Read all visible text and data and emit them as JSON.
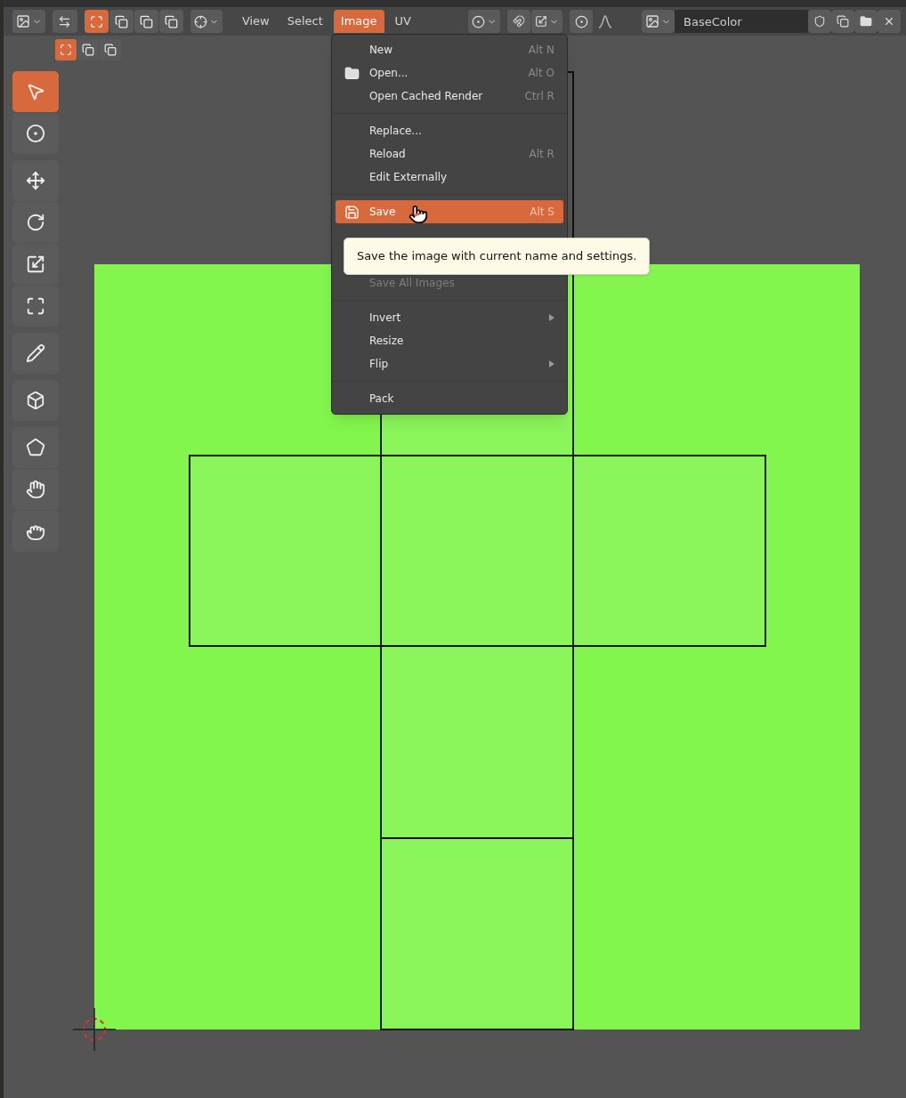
{
  "header": {
    "view_modes": [
      {
        "selected": true
      },
      {
        "selected": false
      },
      {
        "selected": false
      },
      {
        "selected": false
      }
    ],
    "menus": [
      {
        "label": "View",
        "selected": false
      },
      {
        "label": "Select",
        "selected": false
      },
      {
        "label": "Image",
        "selected": true
      },
      {
        "label": "UV",
        "selected": false
      }
    ],
    "image_field": {
      "value": "BaseColor"
    },
    "select_modes": [
      {
        "selected": true
      },
      {
        "selected": false
      },
      {
        "selected": false
      }
    ]
  },
  "image_menu": {
    "items": [
      {
        "kind": "item",
        "label": "New",
        "shortcut": "Alt N",
        "disabled": false,
        "selected": false
      },
      {
        "kind": "item",
        "label": "Open...",
        "shortcut": "Alt O",
        "disabled": false,
        "selected": false
      },
      {
        "kind": "item",
        "label": "Open Cached Render",
        "shortcut": "Ctrl R",
        "disabled": false,
        "selected": false
      },
      {
        "kind": "separator"
      },
      {
        "kind": "item",
        "label": "Replace...",
        "disabled": false,
        "selected": false
      },
      {
        "kind": "item",
        "label": "Reload",
        "shortcut": "Alt R",
        "disabled": false,
        "selected": false
      },
      {
        "kind": "item",
        "label": "Edit Externally",
        "disabled": false,
        "selected": false
      },
      {
        "kind": "separator"
      },
      {
        "kind": "item",
        "label": "Save",
        "shortcut": "Alt S",
        "disabled": false,
        "selected": true
      },
      {
        "kind": "hidden"
      },
      {
        "kind": "hidden"
      },
      {
        "kind": "item",
        "label": "Save All Images",
        "disabled": true,
        "selected": false
      },
      {
        "kind": "separator"
      },
      {
        "kind": "submenu",
        "label": "Invert",
        "disabled": false,
        "selected": false
      },
      {
        "kind": "item",
        "label": "Resize",
        "disabled": false,
        "selected": false
      },
      {
        "kind": "submenu",
        "label": "Flip",
        "disabled": false,
        "selected": false
      },
      {
        "kind": "separator"
      },
      {
        "kind": "item",
        "label": "Pack",
        "disabled": false,
        "selected": false
      }
    ]
  },
  "tooltip": {
    "text": "Save the image with current name and settings."
  },
  "toolbar": {
    "tools": [
      {
        "selected": true
      },
      {
        "selected": false
      },
      {
        "selected": false
      },
      {
        "selected": false
      },
      {
        "selected": false
      },
      {
        "selected": false
      },
      {
        "selected": false
      },
      {
        "selected": false
      },
      {
        "selected": false
      },
      {
        "selected": false
      },
      {
        "selected": false
      }
    ]
  }
}
